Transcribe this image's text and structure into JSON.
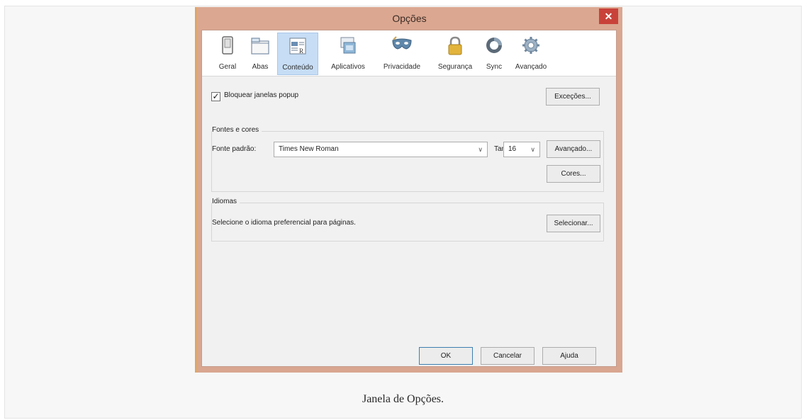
{
  "dialog": {
    "title": "Opções",
    "close_glyph": "✕"
  },
  "toolbar": {
    "tabs": [
      {
        "label": "Geral",
        "icon": "switch-icon"
      },
      {
        "label": "Abas",
        "icon": "tabs-window-icon"
      },
      {
        "label": "Conteúdo",
        "icon": "content-icon",
        "active": true
      },
      {
        "label": "Aplicativos",
        "icon": "applications-icon"
      },
      {
        "label": "Privacidade",
        "icon": "mask-icon"
      },
      {
        "label": "Segurança",
        "icon": "padlock-icon"
      },
      {
        "label": "Sync",
        "icon": "sync-icon"
      },
      {
        "label": "Avançado",
        "icon": "gear-icon"
      }
    ]
  },
  "popup": {
    "checked": true,
    "label": "Bloquear janelas popup",
    "exceptions_button": "Exceções..."
  },
  "fonts": {
    "group_title": "Fontes e cores",
    "default_font_label": "Fonte padrão:",
    "default_font_value": "Times New Roman",
    "size_label": "Tam.:",
    "size_value": "16",
    "advanced_button": "Avançado...",
    "colors_button": "Cores..."
  },
  "languages": {
    "group_title": "Idiomas",
    "description": "Selecione o idioma preferencial para páginas.",
    "select_button": "Selecionar..."
  },
  "footer": {
    "ok_button": "OK",
    "cancel_button": "Cancelar",
    "help_button": "Ajuda"
  },
  "caption": "Janela de Opções.",
  "colors": {
    "titlebar": "#dba791",
    "active_tab": "#c6ddf5",
    "close_button": "#c9423a"
  }
}
